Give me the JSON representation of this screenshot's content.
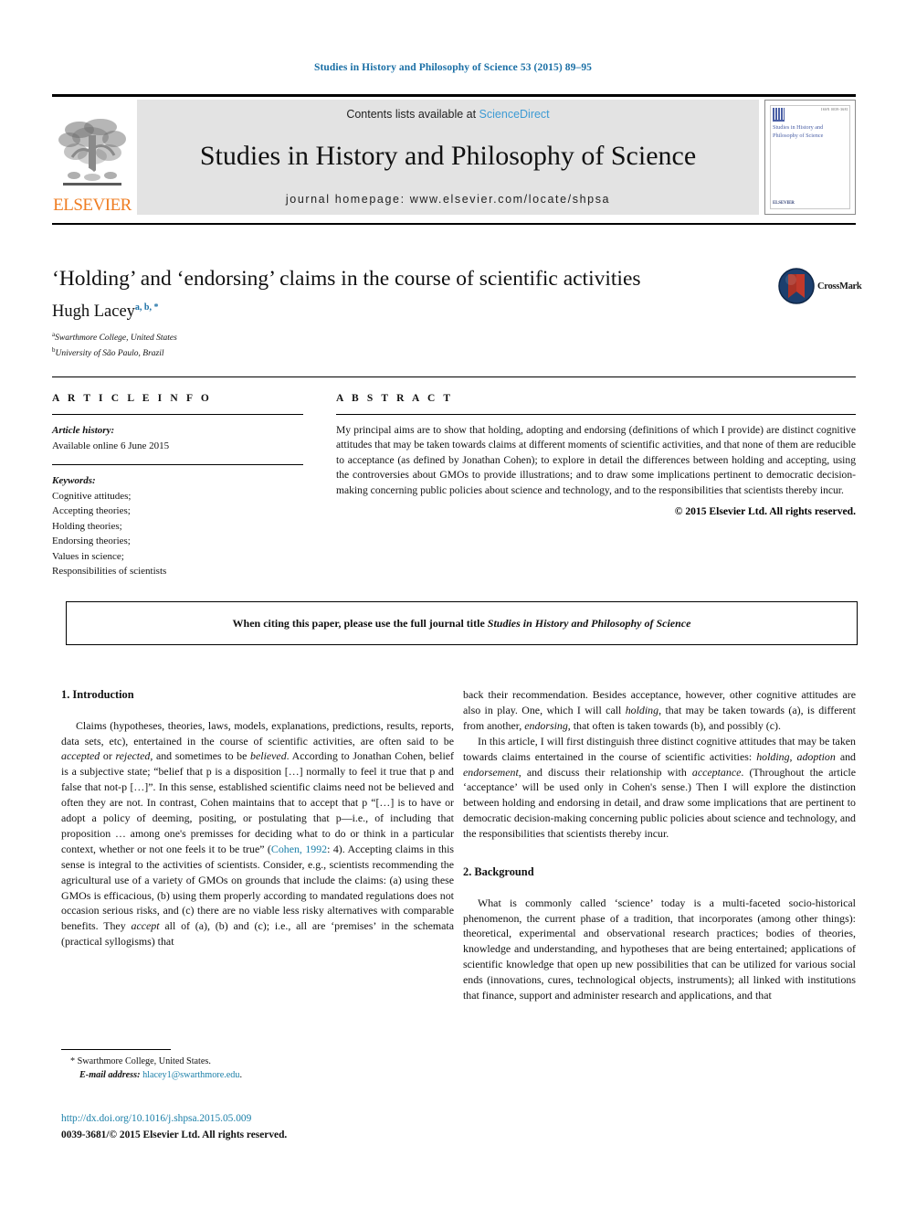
{
  "running_head": "Studies in History and Philosophy of Science 53 (2015) 89–95",
  "masthead": {
    "publisher_name": "ELSEVIER",
    "contents_prefix": "Contents lists available at ",
    "contents_link": "ScienceDirect",
    "journal_title": "Studies in History and Philosophy of Science",
    "homepage": "journal homepage: www.elsevier.com/locate/shpsa",
    "cover": {
      "title": "Studies in History and Philosophy of Science",
      "top_code": "ISSN 0039-3681",
      "footer_brand": "ELSEVIER"
    }
  },
  "article": {
    "title": "‘Holding’ and ‘endorsing’ claims in the course of scientific activities",
    "author": "Hugh Lacey",
    "author_marks": "a, b, *",
    "affiliations": [
      {
        "mark": "a",
        "text": "Swarthmore College, United States"
      },
      {
        "mark": "b",
        "text": "University of São Paulo, Brazil"
      }
    ],
    "crossmark_label": "CrossMark"
  },
  "article_info": {
    "heading": "A R T I C L E   I N F O",
    "history_label": "Article history:",
    "history_value": "Available online 6 June 2015",
    "keywords_label": "Keywords:",
    "keywords": [
      "Cognitive attitudes;",
      "Accepting theories;",
      "Holding theories;",
      "Endorsing theories;",
      "Values in science;",
      "Responsibilities of scientists"
    ]
  },
  "abstract": {
    "heading": "A B S T R A C T",
    "body": "My principal aims are to show that holding, adopting and endorsing (definitions of which I provide) are distinct cognitive attitudes that may be taken towards claims at different moments of scientific activities, and that none of them are reducible to acceptance (as defined by Jonathan Cohen); to explore in detail the differences between holding and accepting, using the controversies about GMOs to provide illustrations; and to draw some implications pertinent to democratic decision-making concerning public policies about science and technology, and to the responsibilities that scientists thereby incur.",
    "copyright": "© 2015 Elsevier Ltd. All rights reserved."
  },
  "citing_note": {
    "prefix": "When citing this paper, please use the full journal title ",
    "journal": "Studies in History and Philosophy of Science"
  },
  "sections": {
    "introduction_heading": "1.  Introduction",
    "background_heading": "2.  Background"
  },
  "body": {
    "left_p1_part1": "Claims (hypotheses, theories, laws, models, explanations, predictions, results, reports, data sets, etc), entertained in the course of scientific activities, are often said to be ",
    "left_p1_em1": "accepted",
    "left_p1_part2": " or ",
    "left_p1_em2": "rejected",
    "left_p1_part3": ", and sometimes to be ",
    "left_p1_em3": "believed",
    "left_p1_part4": ". According to Jonathan Cohen, belief is a subjective state; “belief that p is a disposition […] normally to feel it true that p and false that not-p […]”. In this sense, established scientific claims need not be believed and often they are not. In contrast, Cohen maintains that to accept that p “[…] is to have or adopt a policy of deeming, positing, or postulating that p—i.e., of including that proposition … among one's premisses for deciding what to do or think in a particular context, whether or not one feels it to be true” (",
    "left_p1_cite": "Cohen, 1992",
    "left_p1_part5": ": 4). Accepting claims in this sense is integral to the activities of scientists. Consider, e.g., scientists recommending the agricultural use of a variety of GMOs on grounds that include the claims: (a) using these GMOs is efficacious, (b) using them properly according to mandated regulations does not occasion serious risks, and (c) there are no viable less risky alternatives with comparable benefits. They ",
    "left_p1_em4": "accept",
    "left_p1_part6": " all of (a), (b) and (c); i.e., all are ‘premises’ in the schemata (practical syllogisms) that",
    "right_p1_part1": "back their recommendation. Besides acceptance, however, other cognitive attitudes are also in play. One, which I will call ",
    "right_p1_em1": "holding",
    "right_p1_part2": ", that may be taken towards (a), is different from another, ",
    "right_p1_em2": "endorsing",
    "right_p1_part3": ", that often is taken towards (b), and possibly (c).",
    "right_p2_part1": "In this article, I will first distinguish three distinct cognitive attitudes that may be taken towards claims entertained in the course of scientific activities: ",
    "right_p2_em1": "holding",
    "right_p2_part2": ", ",
    "right_p2_em2": "adoption",
    "right_p2_part3": " and ",
    "right_p2_em3": "endorsement",
    "right_p2_part4": ", and discuss their relationship with ",
    "right_p2_em4": "acceptance",
    "right_p2_part5": ". (Throughout the article ‘acceptance’ will be used only in Cohen's sense.) Then I will explore the distinction between holding and endorsing in detail, and draw some implications that are pertinent to democratic decision-making concerning public policies about science and technology, and the responsibilities that scientists thereby incur.",
    "right_p3": "What is commonly called ‘science’ today is a multi-faceted socio-historical phenomenon, the current phase of a tradition, that incorporates (among other things): theoretical, experimental and observational research practices; bodies of theories, knowledge and understanding, and hypotheses that are being entertained; applications of scientific knowledge that open up new possibilities that can be utilized for various social ends (innovations, cures, technological objects, instruments); all linked with institutions that finance, support and administer research and applications, and that"
  },
  "footnote": {
    "marker": "*",
    "address": "Swarthmore College, United States.",
    "email_label": "E-mail address:",
    "email": "hlacey1@swarthmore.edu",
    "email_suffix": "."
  },
  "footer": {
    "doi": "http://dx.doi.org/10.1016/j.shpsa.2015.05.009",
    "issn_line": "0039-3681/© 2015 Elsevier Ltd. All rights reserved."
  }
}
